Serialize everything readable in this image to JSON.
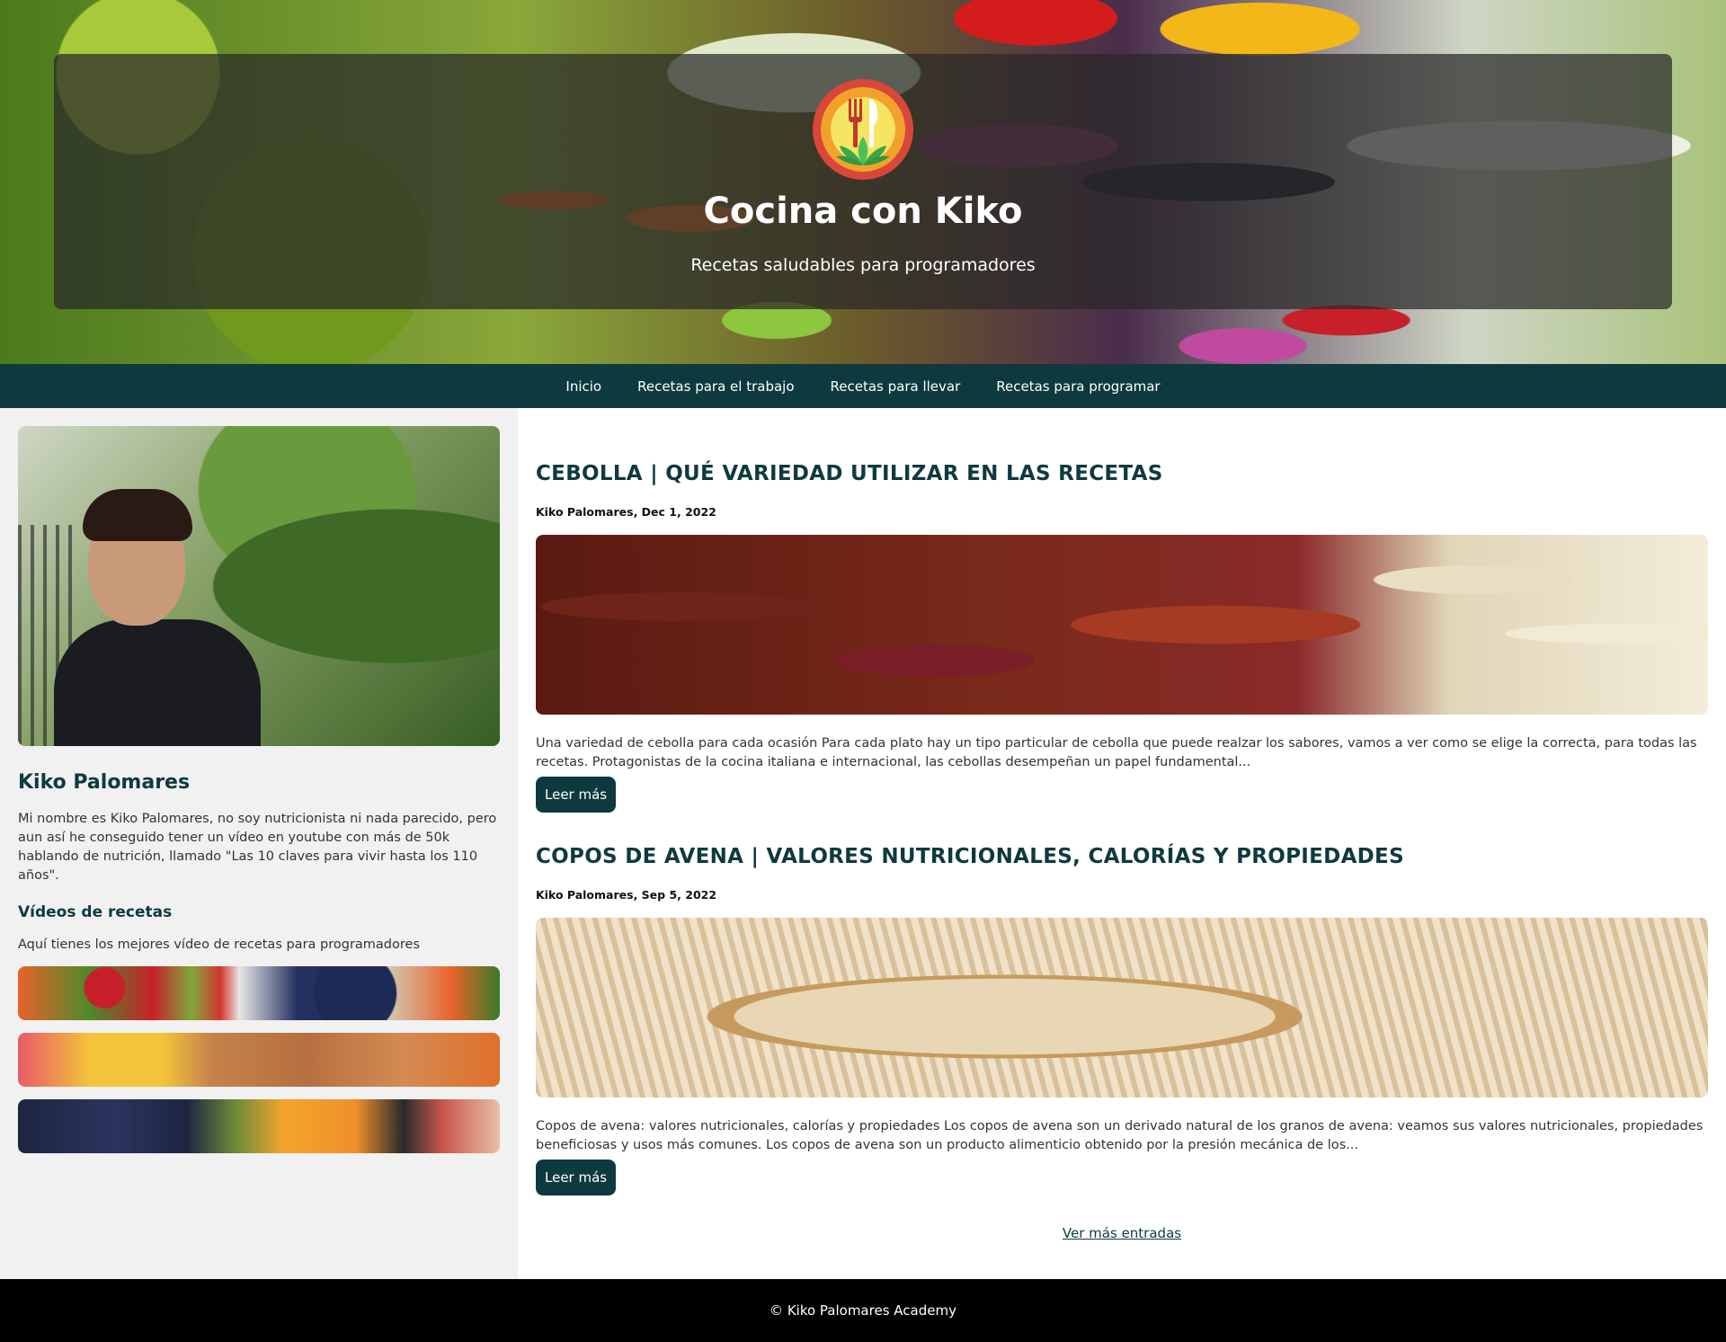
{
  "header": {
    "title": "Cocina con Kiko",
    "subtitle": "Recetas saludables para programadores",
    "logo_icon": "fork-knife-lotus-icon"
  },
  "nav": {
    "items": [
      {
        "label": "Inicio"
      },
      {
        "label": "Recetas para el trabajo"
      },
      {
        "label": "Recetas para llevar"
      },
      {
        "label": "Recetas para programar"
      }
    ]
  },
  "sidebar": {
    "name": "Kiko Palomares",
    "bio": "Mi nombre es Kiko Palomares, no soy nutricionista ni nada parecido, pero aun así he conseguido tener un vídeo en youtube con más de 50k hablando de nutrición, llamado \"Las 10 claves para vivir hasta los 110 años\".",
    "videos_title": "Vídeos de recetas",
    "videos_desc": "Aquí tienes los mejores vídeo de recetas para programadores"
  },
  "posts": [
    {
      "title": "CEBOLLA | QUÉ VARIEDAD UTILIZAR EN LAS RECETAS",
      "meta": "Kiko Palomares, Dec 1, 2022",
      "excerpt": "Una variedad de cebolla para cada ocasión Para cada plato hay un tipo particular de cebolla que puede realzar los sabores, vamos a ver como se elige la correcta, para todas las recetas. Protagonistas de la cocina italiana e internacional, las cebollas desempeñan un papel fundamental...",
      "button": "Leer más"
    },
    {
      "title": "COPOS DE AVENA | VALORES NUTRICIONALES, CALORÍAS Y PROPIEDADES",
      "meta": "Kiko Palomares, Sep 5, 2022",
      "excerpt": "Copos de avena: valores nutricionales, calorías y propiedades Los copos de avena son un derivado natural de los granos de avena: veamos sus valores nutricionales, propiedades beneficiosas y usos más comunes. Los copos de avena son un producto alimenticio obtenido por la presión mecánica de los...",
      "button": "Leer más"
    }
  ],
  "more_entries": "Ver más entradas",
  "footer": {
    "text": "© Kiko Palomares Academy"
  },
  "colors": {
    "primary": "#0e3a3f",
    "sidebar_bg": "#f1f1f1",
    "footer_bg": "#000000"
  }
}
